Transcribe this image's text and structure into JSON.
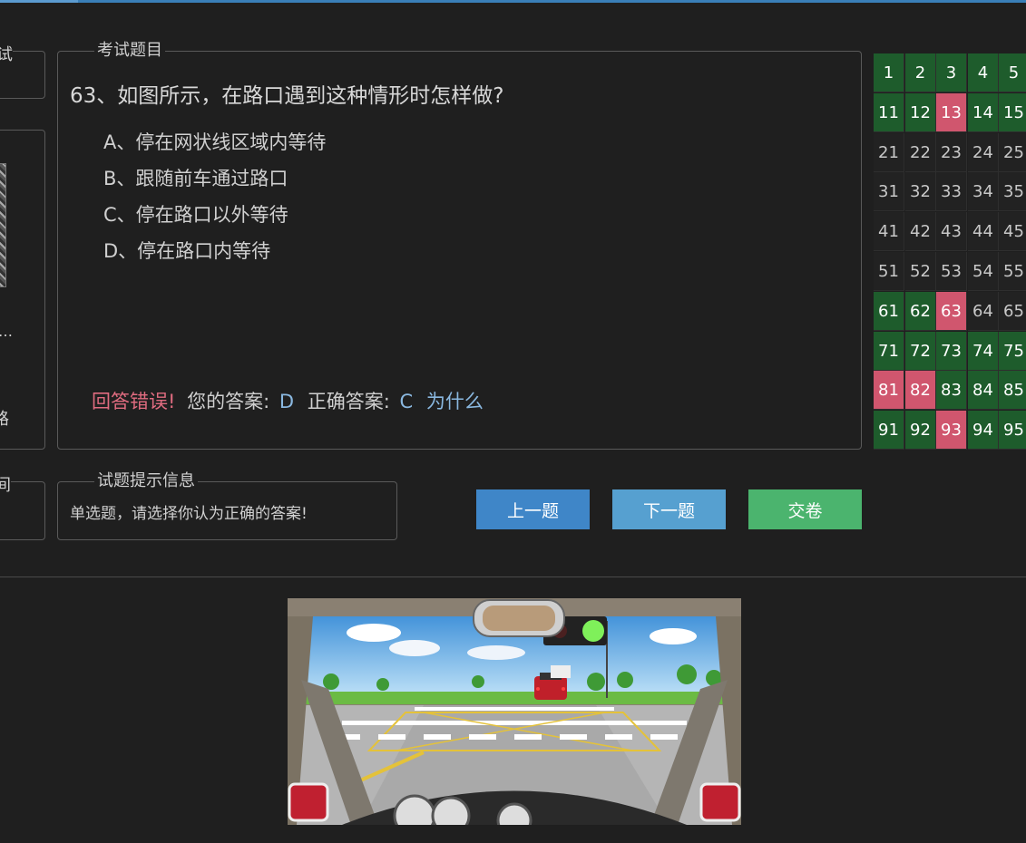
{
  "left_panel": {
    "top_legend_fragment": "试",
    "name_fragment": "…",
    "road_fragment": "路",
    "time_legend_fragment": "间"
  },
  "question_panel": {
    "legend": "考试题目",
    "question": "63、如图所示，在路口遇到这种情形时怎样做?",
    "options": [
      "A、停在网状线区域内等待",
      "B、跟随前车通过路口",
      "C、停在路口以外等待",
      "D、停在路口内等待"
    ],
    "result": {
      "status": "回答错误!",
      "your_answer_label": "您的答案:",
      "your_answer": "D",
      "correct_label": "正确答案:",
      "correct_answer": "C",
      "why_link": "为什么"
    }
  },
  "hint_panel": {
    "legend": "试题提示信息",
    "text": "单选题，请选择你认为正确的答案!"
  },
  "buttons": {
    "prev": "上一题",
    "next": "下一题",
    "submit": "交卷"
  },
  "colors": {
    "correct": "#1e5c2c",
    "wrong": "#d0566e",
    "unanswered": "#222222",
    "prev_button": "#3f86c8",
    "next_button": "#56a0d0",
    "submit_button": "#4bb46e"
  },
  "answer_grid": [
    [
      {
        "n": "1",
        "s": "g"
      },
      {
        "n": "2",
        "s": "g"
      },
      {
        "n": "3",
        "s": "g"
      },
      {
        "n": "4",
        "s": "g"
      },
      {
        "n": "5",
        "s": "g"
      }
    ],
    [
      {
        "n": "11",
        "s": "g"
      },
      {
        "n": "12",
        "s": "g"
      },
      {
        "n": "13",
        "s": "r"
      },
      {
        "n": "14",
        "s": "g"
      },
      {
        "n": "15",
        "s": "g"
      }
    ],
    [
      {
        "n": "21",
        "s": "n"
      },
      {
        "n": "22",
        "s": "n"
      },
      {
        "n": "23",
        "s": "n"
      },
      {
        "n": "24",
        "s": "n"
      },
      {
        "n": "25",
        "s": "n"
      }
    ],
    [
      {
        "n": "31",
        "s": "n"
      },
      {
        "n": "32",
        "s": "n"
      },
      {
        "n": "33",
        "s": "n"
      },
      {
        "n": "34",
        "s": "n"
      },
      {
        "n": "35",
        "s": "n"
      }
    ],
    [
      {
        "n": "41",
        "s": "n"
      },
      {
        "n": "42",
        "s": "n"
      },
      {
        "n": "43",
        "s": "n"
      },
      {
        "n": "44",
        "s": "n"
      },
      {
        "n": "45",
        "s": "n"
      }
    ],
    [
      {
        "n": "51",
        "s": "n"
      },
      {
        "n": "52",
        "s": "n"
      },
      {
        "n": "53",
        "s": "n"
      },
      {
        "n": "54",
        "s": "n"
      },
      {
        "n": "55",
        "s": "n"
      }
    ],
    [
      {
        "n": "61",
        "s": "g"
      },
      {
        "n": "62",
        "s": "g"
      },
      {
        "n": "63",
        "s": "r"
      },
      {
        "n": "64",
        "s": "n"
      },
      {
        "n": "65",
        "s": "n"
      }
    ],
    [
      {
        "n": "71",
        "s": "g"
      },
      {
        "n": "72",
        "s": "g"
      },
      {
        "n": "73",
        "s": "g"
      },
      {
        "n": "74",
        "s": "g"
      },
      {
        "n": "75",
        "s": "g"
      }
    ],
    [
      {
        "n": "81",
        "s": "r"
      },
      {
        "n": "82",
        "s": "r"
      },
      {
        "n": "83",
        "s": "g"
      },
      {
        "n": "84",
        "s": "g"
      },
      {
        "n": "85",
        "s": "g"
      }
    ],
    [
      {
        "n": "91",
        "s": "g"
      },
      {
        "n": "92",
        "s": "g"
      },
      {
        "n": "93",
        "s": "r"
      },
      {
        "n": "94",
        "s": "g"
      },
      {
        "n": "95",
        "s": "g"
      }
    ]
  ],
  "illustration": {
    "icon": "driver-view-intersection-illustration"
  }
}
